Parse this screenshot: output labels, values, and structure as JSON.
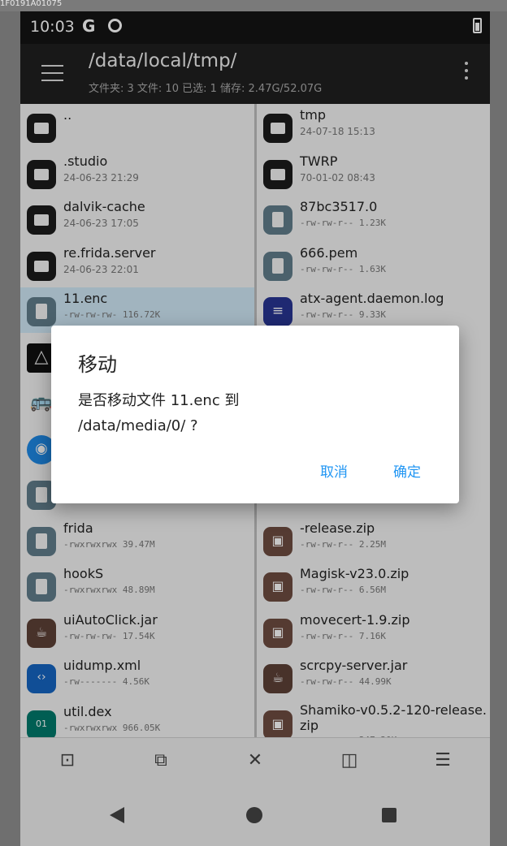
{
  "window_title_fragment": "1F0191A01075",
  "status": {
    "time": "10:03",
    "g_icon": "G"
  },
  "appbar": {
    "path": "/data/local/tmp/",
    "summary": "文件夹: 3  文件: 10  已选: 1  储存: 2.47G/52.07G"
  },
  "left_pane": [
    {
      "name": "..",
      "meta": "",
      "icon": "folder",
      "selected": false,
      "mono": false
    },
    {
      "name": ".studio",
      "meta": "24-06-23 21:29",
      "icon": "folder",
      "selected": false,
      "mono": false
    },
    {
      "name": "dalvik-cache",
      "meta": "24-06-23 17:05",
      "icon": "folder",
      "selected": false,
      "mono": false
    },
    {
      "name": "re.frida.server",
      "meta": "24-06-23 22:01",
      "icon": "folder",
      "selected": false,
      "mono": false
    },
    {
      "name": "11.enc",
      "meta": "-rw-rw-rw-  116.72K",
      "icon": "file",
      "selected": true,
      "mono": true
    },
    {
      "name": "",
      "meta": "",
      "icon": "app1",
      "selected": false,
      "mono": false
    },
    {
      "name": "",
      "meta": "",
      "icon": "app2",
      "selected": false,
      "mono": false
    },
    {
      "name": "",
      "meta": "",
      "icon": "app3",
      "selected": false,
      "mono": false
    },
    {
      "name": "",
      "meta": "-rwxrwxrwx  9.50M",
      "icon": "file",
      "selected": false,
      "mono": true
    },
    {
      "name": "frida",
      "meta": "-rwxrwxrwx  39.47M",
      "icon": "file",
      "selected": false,
      "mono": true
    },
    {
      "name": "hookS",
      "meta": "-rwxrwxrwx  48.89M",
      "icon": "file",
      "selected": false,
      "mono": true
    },
    {
      "name": "uiAutoClick.jar",
      "meta": "-rw-rw-rw-  17.54K",
      "icon": "jar",
      "selected": false,
      "mono": true
    },
    {
      "name": "uidump.xml",
      "meta": "-rw-------  4.56K",
      "icon": "xml",
      "selected": false,
      "mono": true
    },
    {
      "name": "util.dex",
      "meta": "-rwxrwxrwx  966.05K",
      "icon": "dex",
      "selected": false,
      "mono": true
    }
  ],
  "right_pane": [
    {
      "name": "tmp",
      "meta": "24-07-18 15:13",
      "icon": "folder",
      "mono": false
    },
    {
      "name": "TWRP",
      "meta": "70-01-02 08:43",
      "icon": "folder",
      "mono": false
    },
    {
      "name": "87bc3517.0",
      "meta": "-rw-rw-r--  1.23K",
      "icon": "file",
      "mono": true
    },
    {
      "name": "666.pem",
      "meta": "-rw-rw-r--  1.63K",
      "icon": "file",
      "mono": true
    },
    {
      "name": "atx-agent.daemon.log",
      "meta": "-rw-rw-r--  9.33K",
      "icon": "txt",
      "mono": true
    },
    {
      "name": "",
      "meta": "",
      "icon": "none",
      "mono": false
    },
    {
      "name": "",
      "meta": "",
      "icon": "none",
      "mono": false
    },
    {
      "name": "",
      "meta": "",
      "icon": "none",
      "mono": false
    },
    {
      "name": "gisk",
      "meta": "",
      "icon": "none",
      "mono": false
    },
    {
      "name": "-release.zip",
      "meta": "-rw-rw-r--  2.25M",
      "icon": "zip",
      "mono": true
    },
    {
      "name": "Magisk-v23.0.zip",
      "meta": "-rw-rw-r--  6.56M",
      "icon": "zip",
      "mono": true
    },
    {
      "name": "movecert-1.9.zip",
      "meta": "-rw-rw-r--  7.16K",
      "icon": "zip",
      "mono": true
    },
    {
      "name": "scrcpy-server.jar",
      "meta": "-rw-rw-r--  44.99K",
      "icon": "jar",
      "mono": true
    },
    {
      "name": "Shamiko-v0.5.2-120-release.",
      "name2": "zip",
      "meta": "-rw-rw-r--  247.20K",
      "icon": "zip",
      "mono": true
    }
  ],
  "dialog": {
    "title": "移动",
    "message_line1": "是否移动文件 11.enc 到",
    "message_line2": "/data/media/0/ ?",
    "cancel": "取消",
    "ok": "确定"
  },
  "toolbar_icons": [
    "select-all-icon",
    "select-range-icon",
    "clear-selection-icon",
    "split-view-icon",
    "list-view-icon"
  ]
}
